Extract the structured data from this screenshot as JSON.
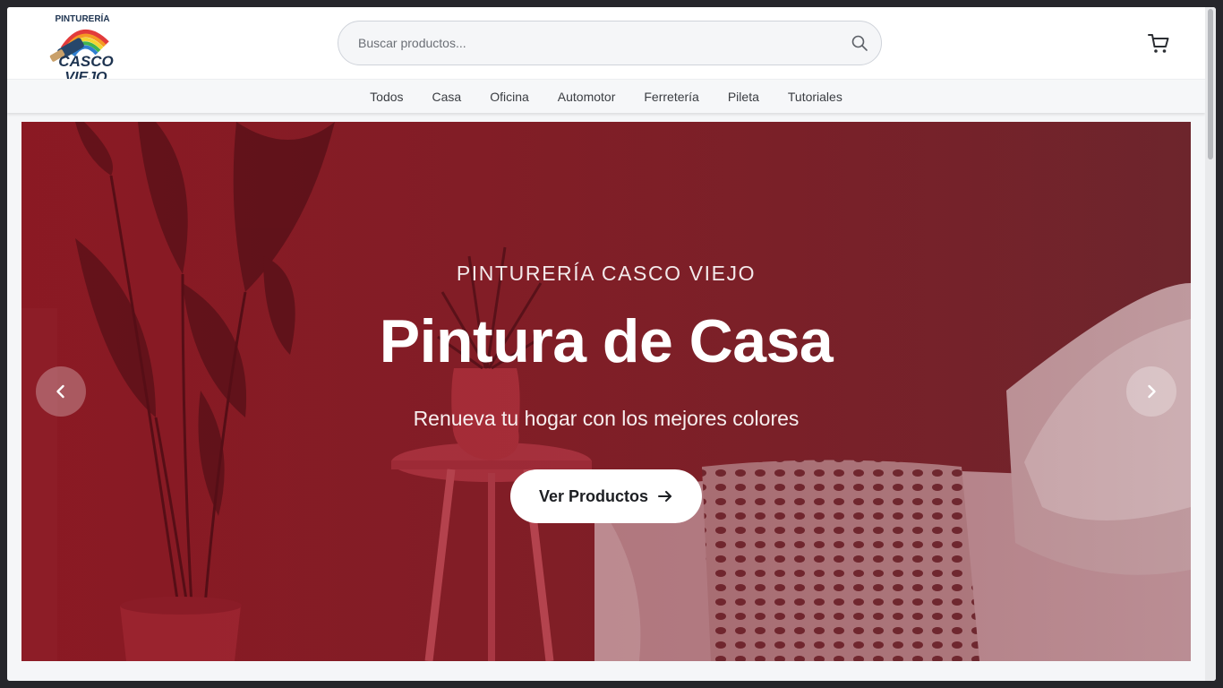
{
  "header": {
    "logo": {
      "line1": "PINTURERÍA",
      "line2": "CASCO",
      "line3": "VIEJO"
    },
    "search": {
      "placeholder": "Buscar productos...",
      "value": ""
    }
  },
  "nav": {
    "items": [
      {
        "label": "Todos"
      },
      {
        "label": "Casa"
      },
      {
        "label": "Oficina"
      },
      {
        "label": "Automotor"
      },
      {
        "label": "Ferretería"
      },
      {
        "label": "Pileta"
      },
      {
        "label": "Tutoriales"
      }
    ]
  },
  "hero": {
    "kicker": "PINTURERÍA CASCO VIEJO",
    "title": "Pintura de Casa",
    "subtitle": "Renueva tu hogar con los mejores colores",
    "cta_label": "Ver Productos"
  },
  "icons": {
    "search": "search-icon",
    "cart": "cart-icon",
    "prev": "chevron-left-icon",
    "next": "chevron-right-icon",
    "cta": "arrow-right-icon"
  },
  "colors": {
    "hero_tint": "#7d1f27",
    "page_bg": "#f5f6f8",
    "header_bg": "#ffffff",
    "frame_bg": "#26262b"
  }
}
